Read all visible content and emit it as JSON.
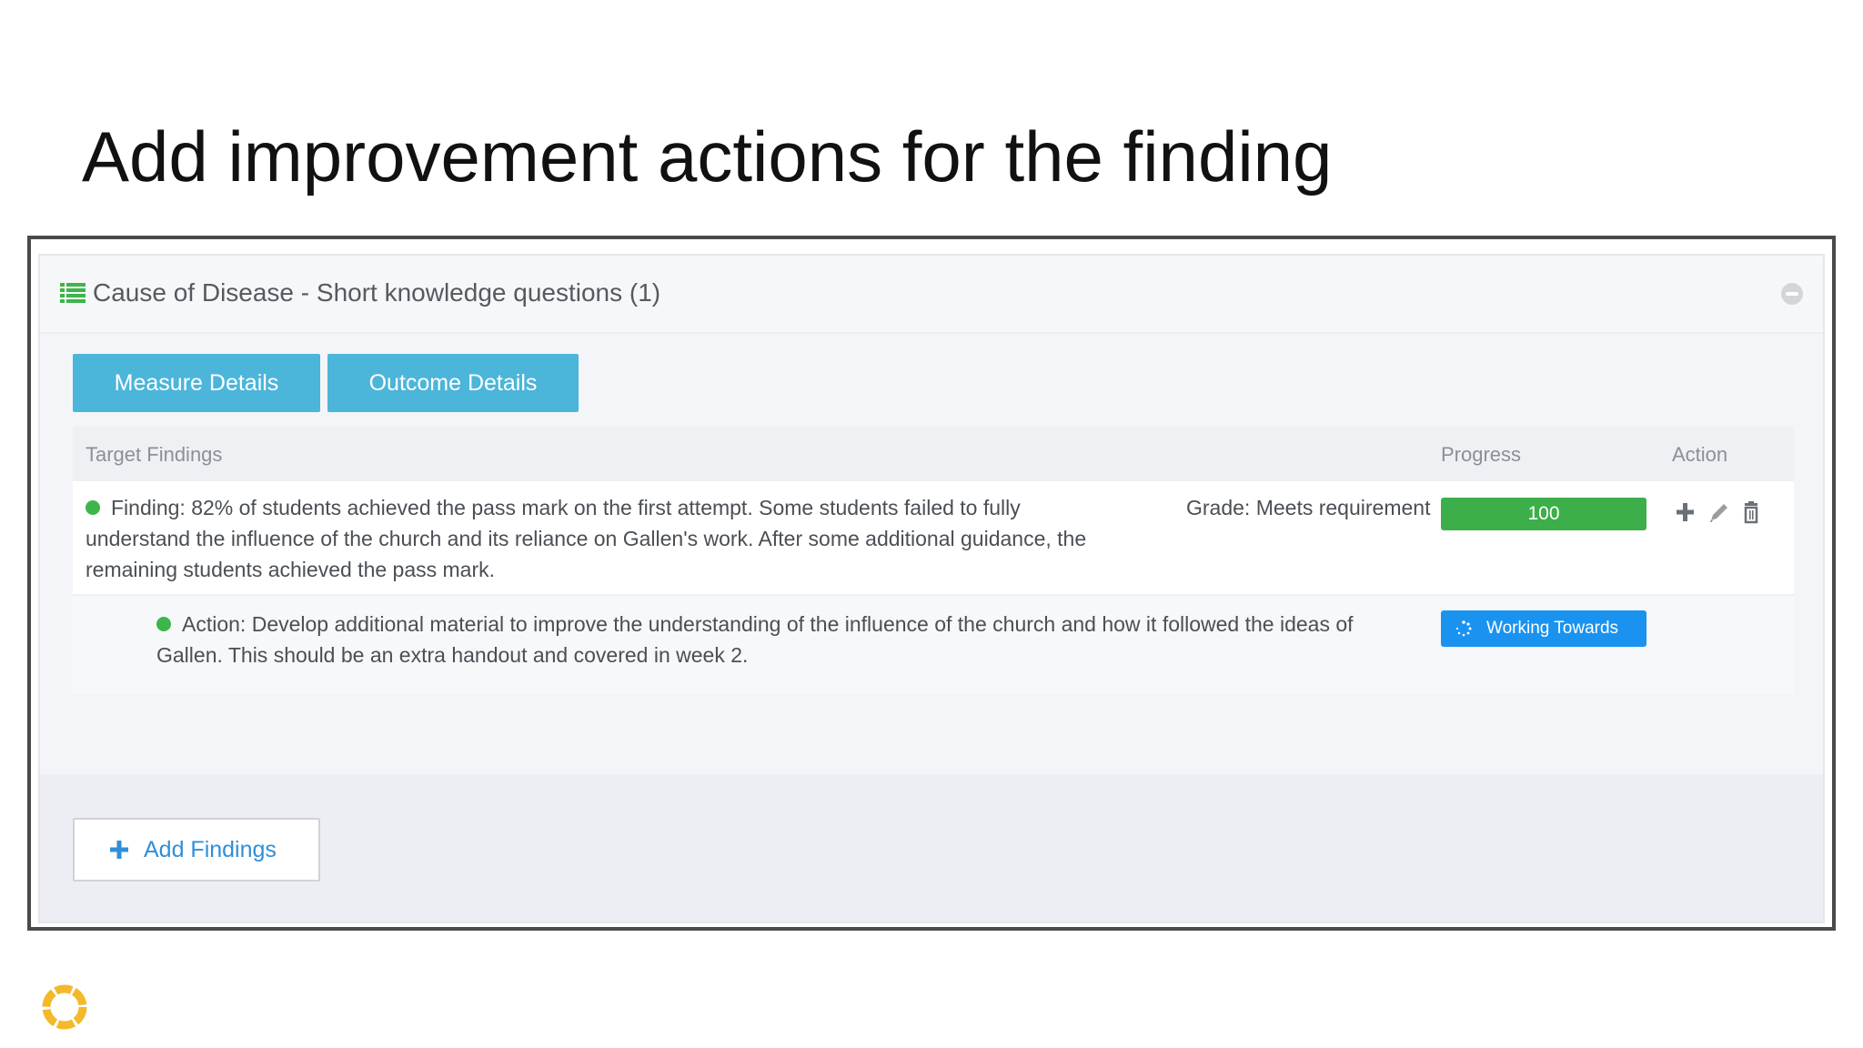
{
  "slide": {
    "title": "Add improvement actions for the finding"
  },
  "panel": {
    "title": "Cause of Disease - Short knowledge questions (1)",
    "header_icon": "list-icon",
    "collapse_icon": "minus-circle-icon"
  },
  "tabs": [
    {
      "label": "Measure Details"
    },
    {
      "label": "Outcome Details"
    }
  ],
  "table": {
    "headers": {
      "findings": "Target Findings",
      "progress": "Progress",
      "action": "Action"
    },
    "finding": {
      "text": "Finding: 82% of students achieved the pass mark on the first attempt. Some students failed to fully understand the influence of the church and its reliance on Gallen's work. After some additional guidance, the remaining students achieved the pass mark.",
      "grade": "Grade: Meets requirement",
      "progress_percent": 100,
      "progress_label": "100",
      "status_color": "#3db54a",
      "action_icons": [
        "plus-icon",
        "pencil-icon",
        "trash-icon"
      ]
    },
    "improvement_action": {
      "text": "Action: Develop additional material to improve the understanding of the influence of the church and how it followed the ideas of Gallen. This should be an extra handout and covered in week 2.",
      "status": "Working Towards",
      "status_icon": "spinner-icon",
      "status_color": "#1a93f0"
    }
  },
  "footer": {
    "add_findings_label": "Add Findings"
  },
  "colors": {
    "tab_bg": "#4cb5da",
    "progress_green": "#3cae4a",
    "link_blue": "#2f8fd9",
    "logo_yellow": "#f3b92b"
  }
}
